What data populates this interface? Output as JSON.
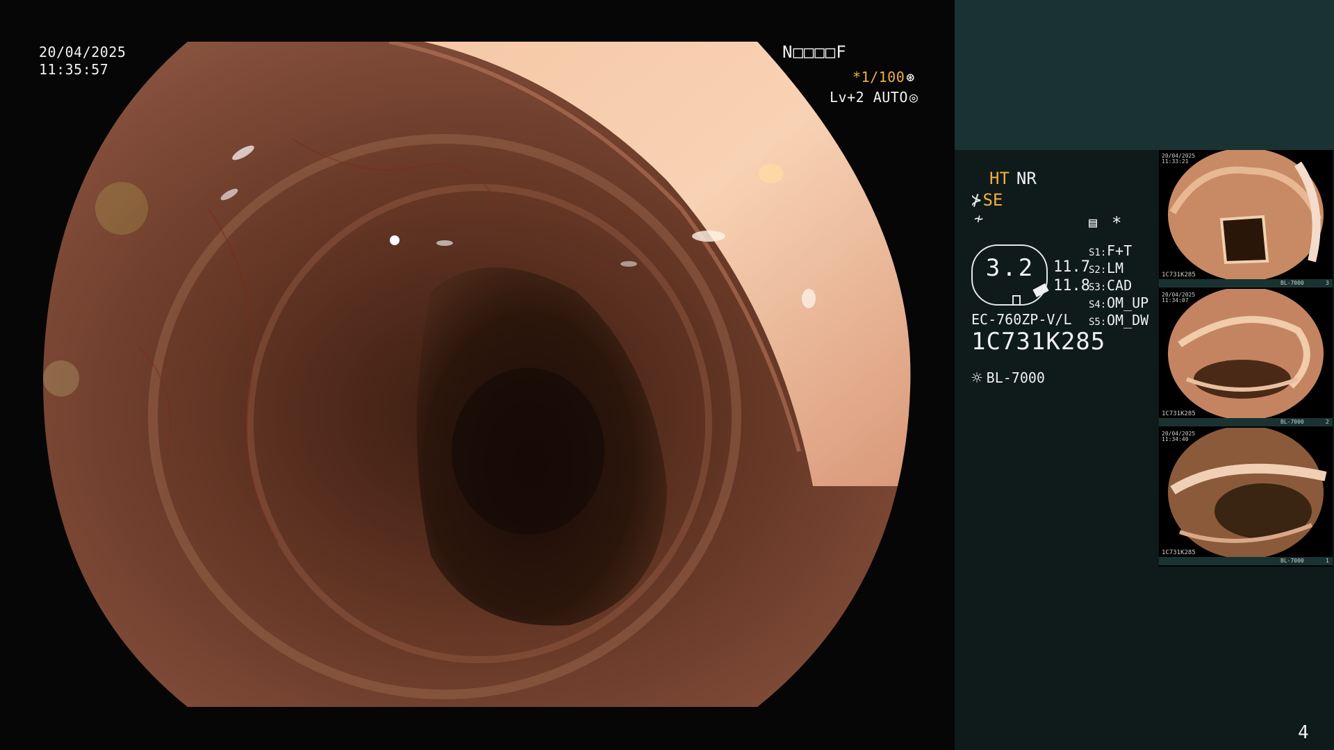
{
  "overlay": {
    "date": "20/04/2025",
    "time": "11:35:57",
    "patient_id": "N□□□□F",
    "shutter": "*1/100",
    "shutter_icon": "aperture-icon",
    "level": "Lv+2 AUTO",
    "level_icon": "iris-icon"
  },
  "panel": {
    "ht": "HT",
    "nr": "NR",
    "se": "SE",
    "se_icon": "scope-tip-icon",
    "f_icon": "filter-icon",
    "doc_icon": "report-icon",
    "star": "*",
    "zoom": "3.2",
    "zoom_values": [
      "11.7",
      "11.8"
    ],
    "settings": [
      {
        "key": "S1:",
        "value": "F+T"
      },
      {
        "key": "S2:",
        "value": "LM"
      },
      {
        "key": "S3:",
        "value": "CAD"
      },
      {
        "key": "S4:",
        "value": "OM_UP"
      },
      {
        "key": "S5:",
        "value": "OM_DW"
      }
    ],
    "scope_model": "EC-760ZP-V/L",
    "serial": "1C731K285",
    "light_source": "BL-7000",
    "light_icon": "lamp-icon",
    "page_number": "4"
  },
  "thumbnails": [
    {
      "date": "20/04/2025",
      "time": "11:33:21",
      "serial": "1C731K285",
      "light": "BL-7000",
      "index": "3"
    },
    {
      "date": "20/04/2025",
      "time": "11:34:07",
      "serial": "1C731K285",
      "light": "BL-7000",
      "index": "2"
    },
    {
      "date": "20/04/2025",
      "time": "11:34:40",
      "serial": "1C731K285",
      "light": "BL-7000",
      "index": "1"
    }
  ],
  "colors": {
    "panel_bg": "#0f1a1a",
    "panel_header": "#1a3332",
    "accent_amber": "#f0b040"
  }
}
